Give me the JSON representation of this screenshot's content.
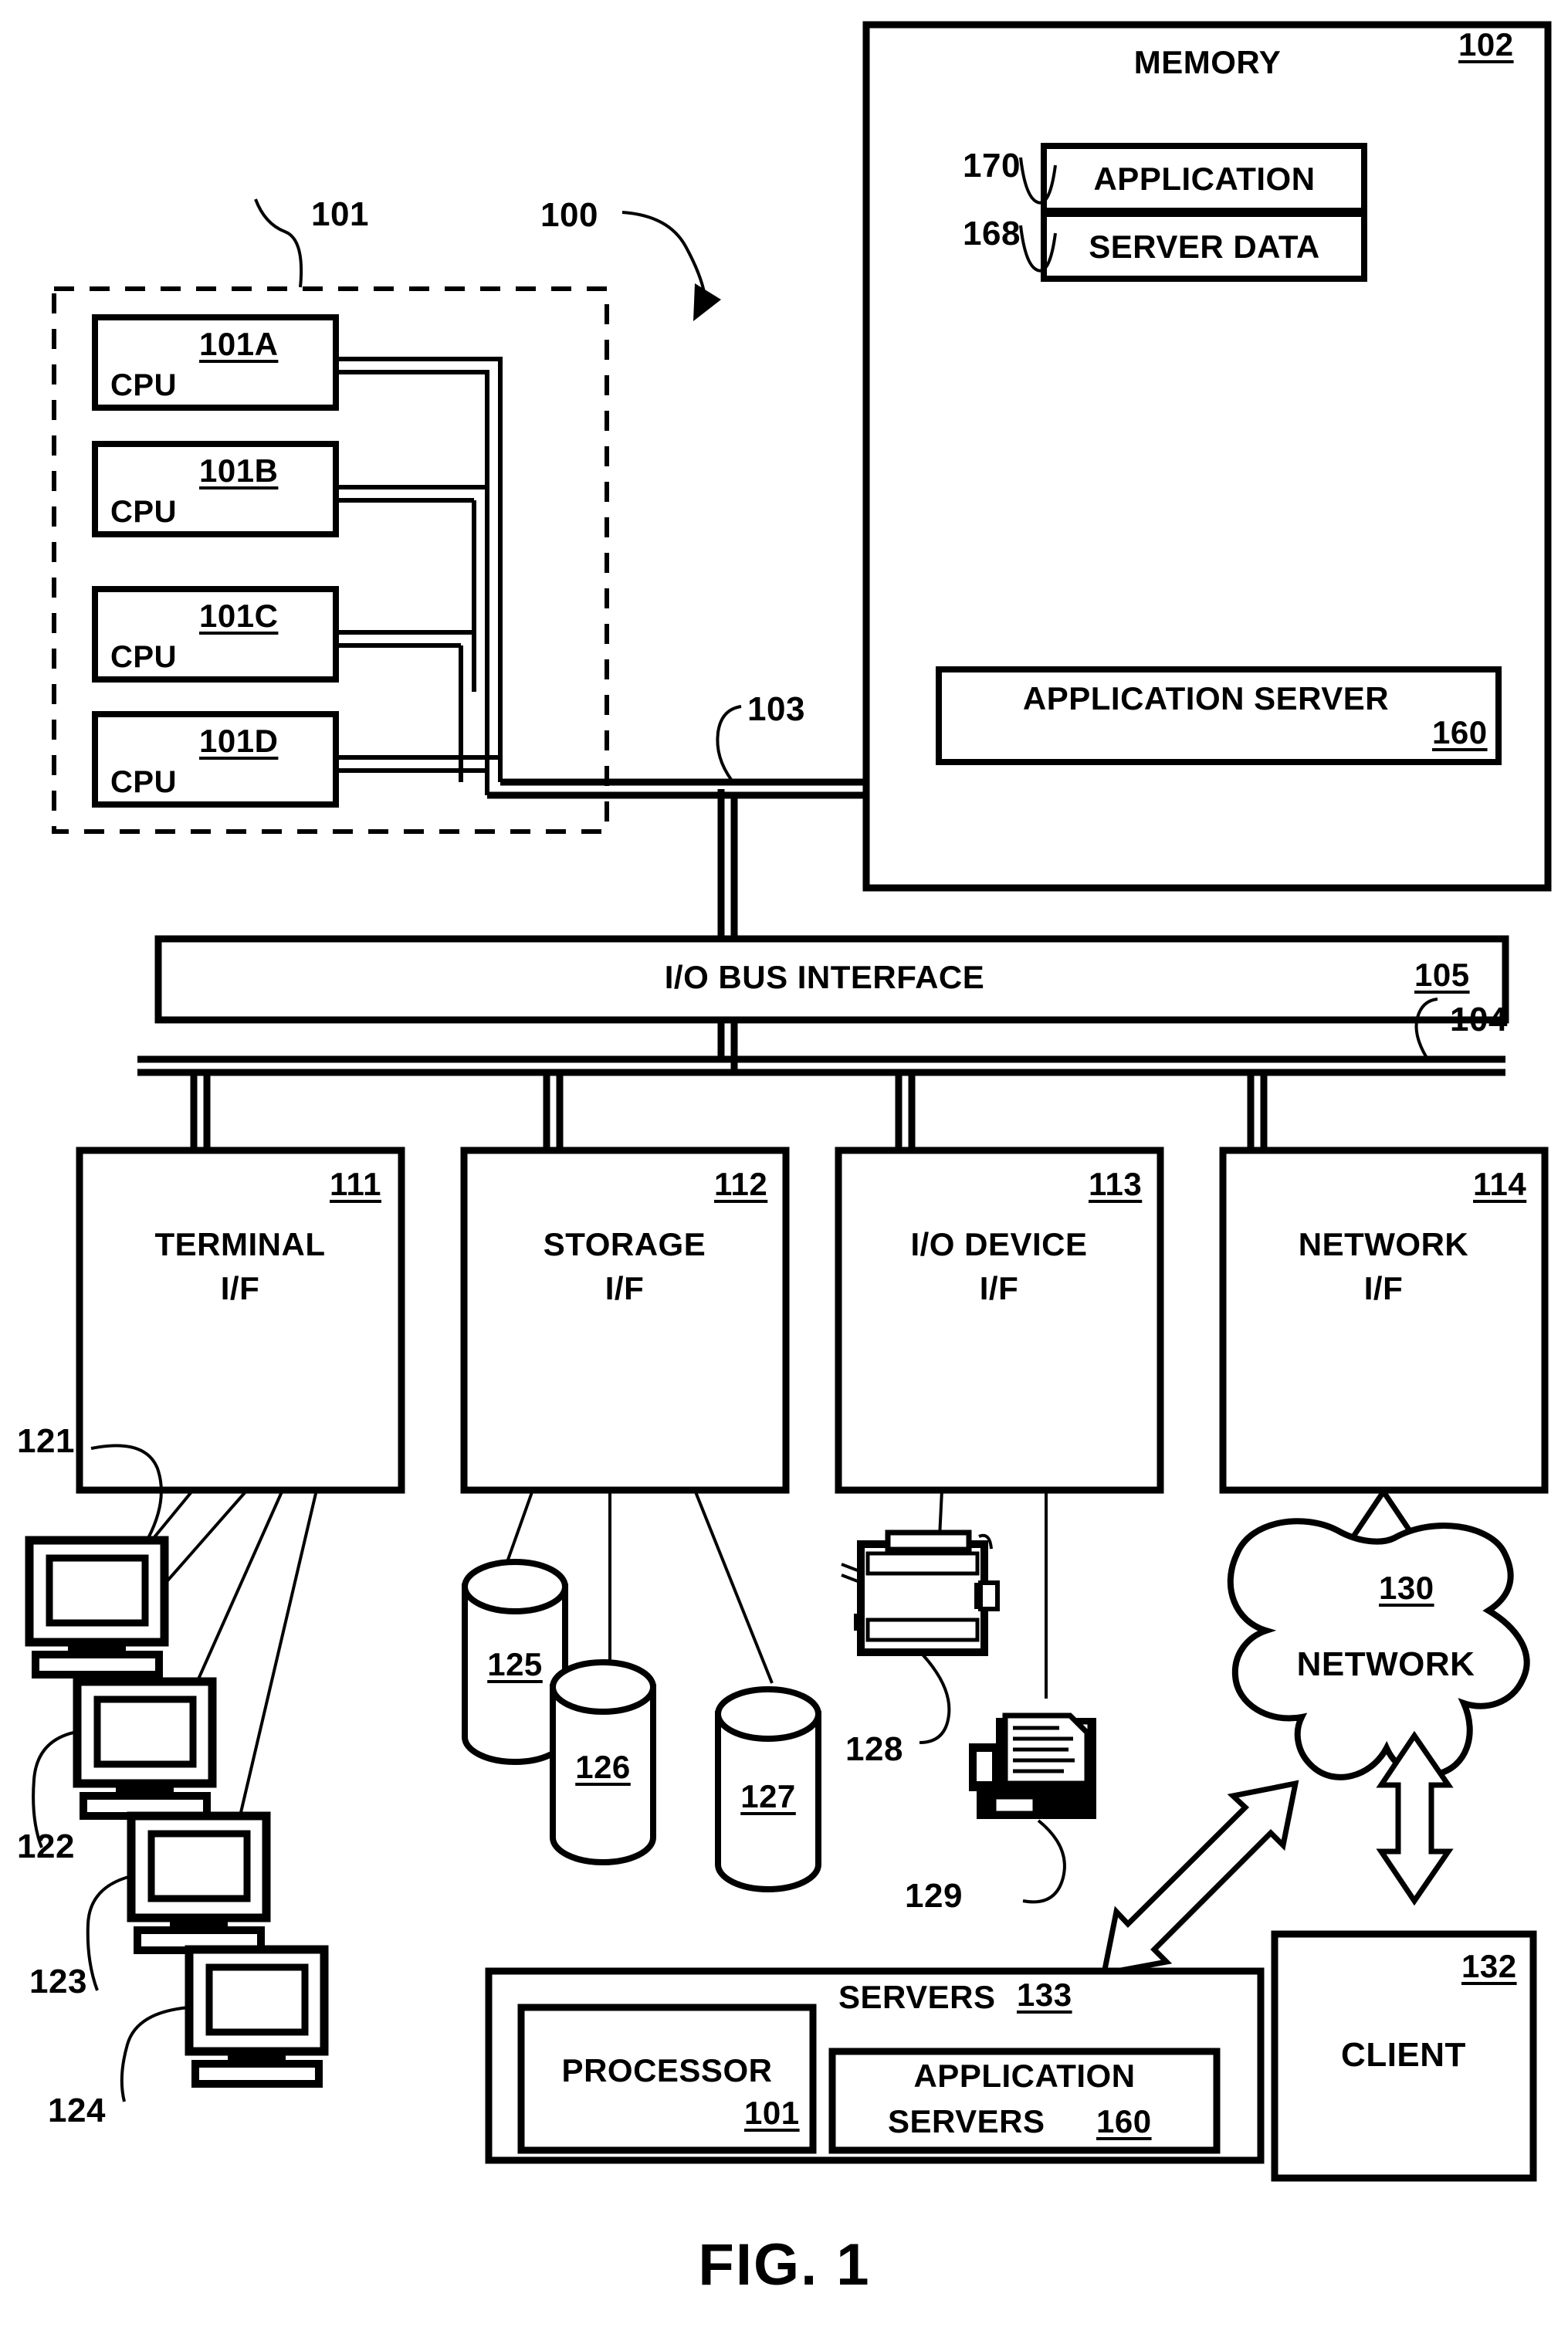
{
  "figure": {
    "caption": "FIG. 1",
    "system_ref": "100"
  },
  "processor_cluster": {
    "ref": "101",
    "cpus": [
      {
        "label": "CPU",
        "ref": "101A"
      },
      {
        "label": "CPU",
        "ref": "101B"
      },
      {
        "label": "CPU",
        "ref": "101C"
      },
      {
        "label": "CPU",
        "ref": "101D"
      }
    ]
  },
  "memory": {
    "title": "MEMORY",
    "ref": "102",
    "bus_ref": "103",
    "blocks": [
      {
        "label": "APPLICATION",
        "ref": "170"
      },
      {
        "label": "SERVER DATA",
        "ref": "168"
      }
    ],
    "application_server": {
      "label": "APPLICATION SERVER",
      "ref": "160"
    }
  },
  "io_bus_interface": {
    "label": "I/O BUS INTERFACE",
    "ref": "105"
  },
  "io_bus": {
    "ref": "104"
  },
  "interfaces": [
    {
      "line1": "TERMINAL",
      "line2": "I/F",
      "ref": "111"
    },
    {
      "line1": "STORAGE",
      "line2": "I/F",
      "ref": "112"
    },
    {
      "line1": "I/O DEVICE",
      "line2": "I/F",
      "ref": "113"
    },
    {
      "line1": "NETWORK",
      "line2": "I/F",
      "ref": "114"
    }
  ],
  "terminals": [
    {
      "ref": "121"
    },
    {
      "ref": "122"
    },
    {
      "ref": "123"
    },
    {
      "ref": "124"
    }
  ],
  "storage_devices": [
    {
      "ref": "125"
    },
    {
      "ref": "126"
    },
    {
      "ref": "127"
    }
  ],
  "io_devices": [
    {
      "ref": "128",
      "kind": "tape-drive-icon"
    },
    {
      "ref": "129",
      "kind": "printer-icon"
    }
  ],
  "network": {
    "label": "NETWORK",
    "ref": "130"
  },
  "client": {
    "label": "CLIENT",
    "ref": "132"
  },
  "servers": {
    "label": "SERVERS",
    "ref": "133",
    "processor": {
      "label": "PROCESSOR",
      "ref": "101"
    },
    "application_servers": {
      "line1": "APPLICATION",
      "line2": "SERVERS",
      "ref": "160"
    }
  },
  "colors": {
    "ink": "#000000",
    "paper": "#ffffff"
  }
}
